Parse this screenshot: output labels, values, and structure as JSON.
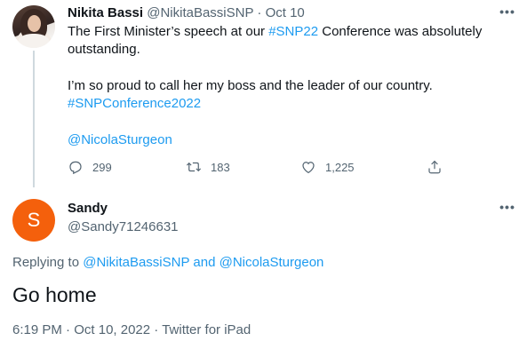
{
  "parent_tweet": {
    "author_name": "Nikita Bassi",
    "author_handle": "@NikitaBassiSNP",
    "separator": "·",
    "date": "Oct 10",
    "line1_prefix": "The First Minister’s speech at our ",
    "line1_hashtag": "#SNP22",
    "line1_suffix": " Conference was absolutely outstanding.",
    "line2": "I’m so proud to call her my boss and the leader of our country.",
    "line2_hashtag": "#SNPConference2022",
    "mention": "@NicolaSturgeon",
    "more_icon": "more-horizontal-icon",
    "actions": {
      "reply_icon": "reply-icon",
      "reply_count": "299",
      "retweet_icon": "retweet-icon",
      "retweet_count": "183",
      "like_icon": "heart-icon",
      "like_count": "1,225",
      "share_icon": "share-icon"
    }
  },
  "reply_tweet": {
    "avatar_letter": "S",
    "avatar_color": "#f4600c",
    "author_name": "Sandy",
    "author_handle": "@Sandy71246631",
    "more_icon": "more-horizontal-icon",
    "replying_to_label": "Replying to",
    "replying_to_user1": "@NikitaBassiSNP",
    "replying_to_and": "and",
    "replying_to_user2": "@NicolaSturgeon",
    "text": "Go home",
    "time": "6:19 PM",
    "separator": "·",
    "date": "Oct 10, 2022",
    "source": "Twitter for iPad"
  },
  "colors": {
    "link": "#1d9bf0",
    "muted": "#536471",
    "thread_line": "#cfd9de"
  }
}
